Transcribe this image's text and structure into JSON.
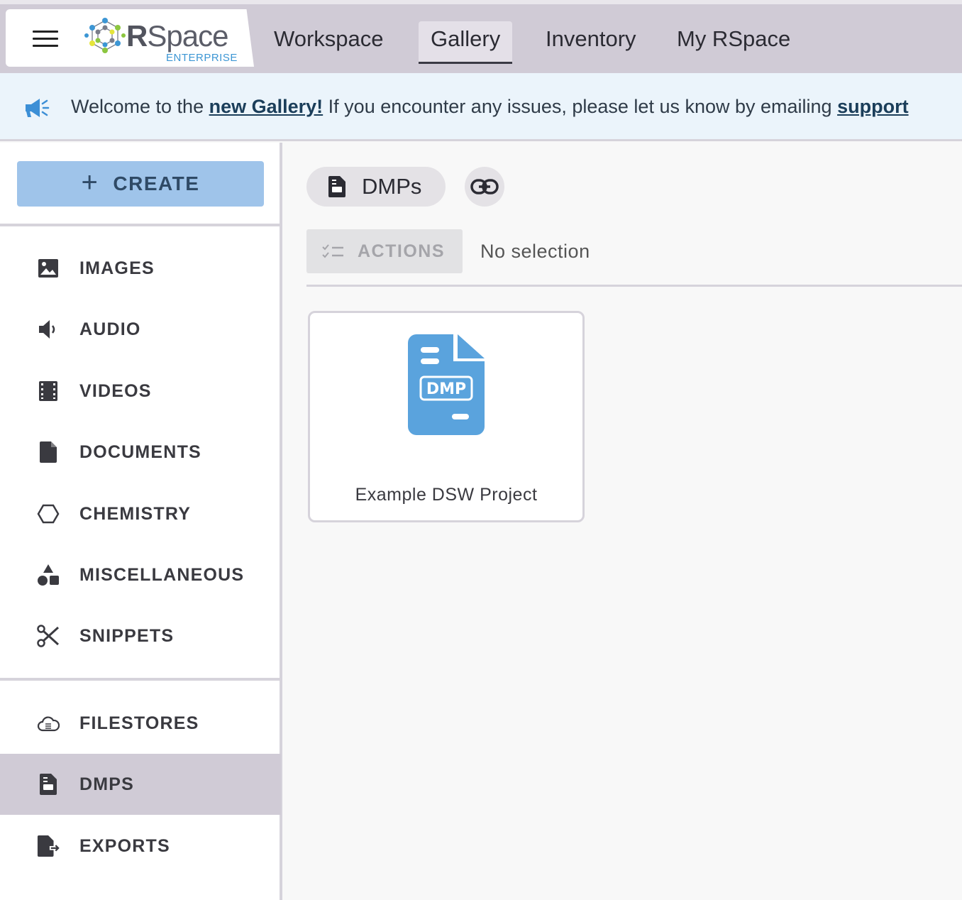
{
  "app": {
    "brand_name": "RSpace",
    "brand_sub": "ENTERPRISE"
  },
  "nav": {
    "items": [
      {
        "label": "Workspace"
      },
      {
        "label": "Gallery",
        "active": true
      },
      {
        "label": "Inventory"
      },
      {
        "label": "My RSpace"
      }
    ]
  },
  "banner": {
    "prefix": "Welcome to the ",
    "link1": "new Gallery!",
    "middle": " If you encounter any issues, please let us know by emailing ",
    "link2": "support"
  },
  "sidebar": {
    "create_label": "CREATE",
    "items": [
      {
        "label": "IMAGES",
        "icon": "image-icon"
      },
      {
        "label": "AUDIO",
        "icon": "volume-icon"
      },
      {
        "label": "VIDEOS",
        "icon": "film-icon"
      },
      {
        "label": "DOCUMENTS",
        "icon": "document-icon"
      },
      {
        "label": "CHEMISTRY",
        "icon": "hexagon-icon"
      },
      {
        "label": "MISCELLANEOUS",
        "icon": "shapes-icon"
      },
      {
        "label": "SNIPPETS",
        "icon": "scissors-icon"
      }
    ],
    "items2": [
      {
        "label": "FILESTORES",
        "icon": "cloud-icon"
      },
      {
        "label": "DMPS",
        "icon": "dmp-file-icon",
        "active": true
      },
      {
        "label": "EXPORTS",
        "icon": "export-file-icon"
      }
    ]
  },
  "main": {
    "breadcrumb": "DMPs",
    "actions_label": "ACTIONS",
    "selection_text": "No selection",
    "files": [
      {
        "name": "Example DSW Project",
        "badge": "DMP"
      }
    ]
  },
  "colors": {
    "topbar": "#d0cbd6",
    "accent": "#5aa3dd",
    "create": "#9fc4ea"
  }
}
